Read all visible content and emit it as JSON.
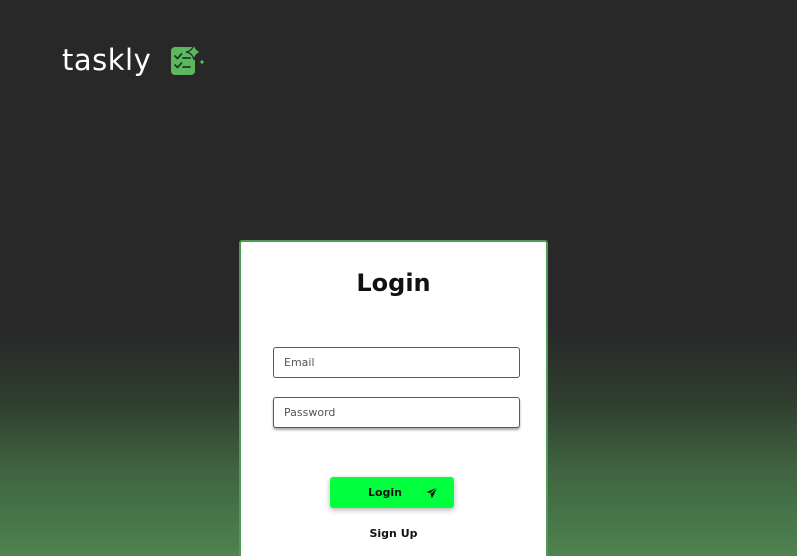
{
  "brand": {
    "name": "taskly",
    "icon": "tasklist-sparkle-icon",
    "accent_color": "#5cb85f"
  },
  "login_card": {
    "title": "Login",
    "border_color": "#4f9a55",
    "email": {
      "placeholder": "Email",
      "value": ""
    },
    "password": {
      "placeholder": "Password",
      "value": ""
    },
    "login_button": {
      "label": "Login",
      "icon": "send-icon",
      "color": "#00ff3c"
    },
    "signup_link": {
      "label": "Sign Up"
    }
  }
}
